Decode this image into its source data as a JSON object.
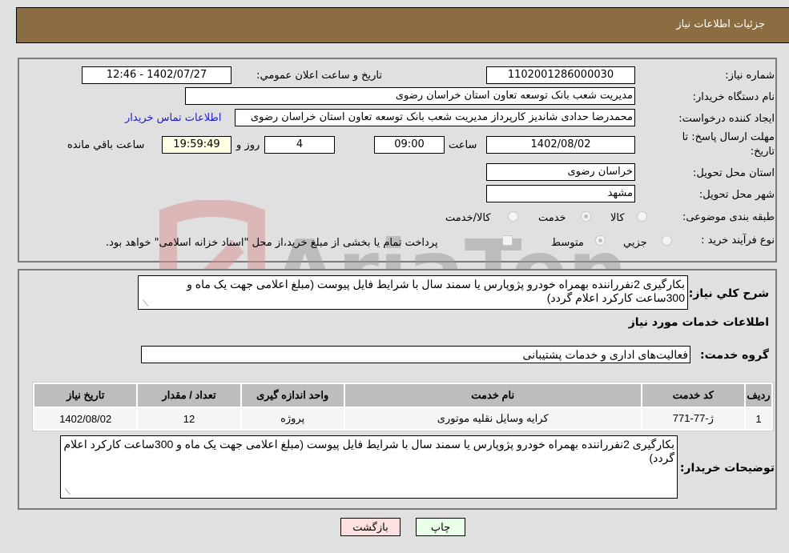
{
  "header": {
    "title": "جزئیات اطلاعات نیاز"
  },
  "form": {
    "need_number": {
      "label": "شماره نیاز:",
      "value": "1102001286000030"
    },
    "announce_datetime": {
      "label": "تاریخ و ساعت اعلان عمومي:",
      "value": "1402/07/27 - 12:46"
    },
    "buyer_org": {
      "label": "نام دستگاه خریدار:",
      "value": "مدیریت شعب بانک توسعه تعاون استان خراسان رضوی"
    },
    "requester": {
      "label": "ایجاد کننده درخواست:",
      "value": "محمدرضا حدادی شاندیز کارپرداز مدیریت شعب بانک توسعه تعاون استان خراسان رضوی",
      "contact_link": "اطلاعات تماس خریدار"
    },
    "deadline": {
      "label_line1": "مهلت ارسال پاسخ: تا",
      "label_line2": "تاریخ:",
      "date": "1402/08/02",
      "time_label": "ساعت",
      "time": "09:00",
      "days": "4",
      "days_label": "روز و",
      "remaining": "19:59:49",
      "remaining_label": "ساعت باقي مانده"
    },
    "delivery_province": {
      "label": "استان محل تحویل:",
      "value": "خراسان رضوی"
    },
    "delivery_city": {
      "label": "شهر محل تحویل:",
      "value": "مشهد"
    },
    "category": {
      "label": "طبقه بندی موضوعی:",
      "options": [
        "کالا",
        "خدمت",
        "کالا/خدمت"
      ],
      "selected": "خدمت"
    },
    "purchase_type": {
      "label": "نوع فرآیند خرید :",
      "options": [
        "جزيي",
        "متوسط"
      ],
      "selected": "متوسط",
      "treasury_note": "پرداخت تمام یا بخشی از مبلغ خرید،از محل \"اسناد خزانه اسلامی\" خواهد بود."
    }
  },
  "details": {
    "general_description_label": "شرح كلي نياز:",
    "general_description": "بکارگیری 2نفرراننده بهمراه خودرو پژوپارس یا سمند سال با شرایط فایل پیوست (مبلغ اعلامی جهت یک ماه و 300ساعت کارکرد اعلام گردد)",
    "services_heading": "اطلاعات خدمات مورد نیاز",
    "service_group_label": "گروه خدمت:",
    "service_group": "فعالیت‌های اداری و خدمات پشتیبانی",
    "table": {
      "headers": [
        "ردیف",
        "کد خدمت",
        "نام خدمت",
        "واحد اندازه گیری",
        "تعداد / مقدار",
        "تاریخ نیاز"
      ],
      "rows": [
        [
          "1",
          "ژ-77-771",
          "کرایه وسایل نقلیه موتوری",
          "پروژه",
          "12",
          "1402/08/02"
        ]
      ]
    },
    "buyer_notes_label": "توضیحات خریدار:",
    "buyer_notes": "بکارگیری 2نفرراننده بهمراه خودرو پژوپارس یا سمند سال با شرایط فایل پیوست (مبلغ اعلامی جهت یک ماه و 300ساعت کارکرد اعلام گردد)"
  },
  "buttons": {
    "print": "چاپ",
    "back": "بازگشت"
  },
  "watermark": {
    "text": "AriaTender.neT"
  },
  "colors": {
    "header_bg": "#8b6d42",
    "print_bg": "#eaffea",
    "back_bg": "#ffe0e0",
    "link": "#1a1acc",
    "remaining_bg": "#ffffe6"
  }
}
